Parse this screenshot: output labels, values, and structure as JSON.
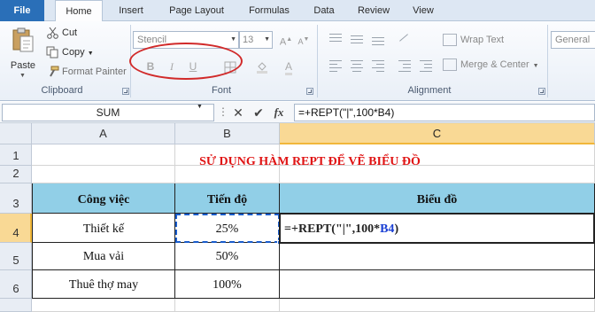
{
  "ribbon_tabs": {
    "file": "File",
    "home": "Home",
    "insert": "Insert",
    "page_layout": "Page Layout",
    "formulas": "Formulas",
    "data": "Data",
    "review": "Review",
    "view": "View"
  },
  "clipboard": {
    "paste": "Paste",
    "cut": "Cut",
    "copy": "Copy",
    "format_painter": "Format Painter",
    "group_label": "Clipboard"
  },
  "font": {
    "name": "Stencil",
    "size": "13",
    "bold": "B",
    "italic": "I",
    "underline": "U",
    "grow": "A",
    "shrink": "A",
    "font_color": "A",
    "group_label": "Font"
  },
  "alignment": {
    "wrap_text": "Wrap Text",
    "merge_center": "Merge & Center",
    "group_label": "Alignment"
  },
  "number": {
    "format": "General"
  },
  "formula_bar": {
    "name_box": "SUM",
    "cancel": "✕",
    "enter": "✔",
    "fx": "fx",
    "formula": "=+REPT(\"|\",100*B4)"
  },
  "sheet": {
    "columns": [
      "A",
      "B",
      "C"
    ],
    "rows": [
      "1",
      "2",
      "3",
      "4",
      "5",
      "6"
    ],
    "title": "SỬ DỤNG HÀM REPT ĐỂ VẼ BIỂU ĐỒ",
    "headers": [
      "Công việc",
      "Tiến độ",
      "Biểu đồ"
    ],
    "data_rows": [
      {
        "task": "Thiết kế",
        "progress": "25%"
      },
      {
        "task": "Mua vải",
        "progress": "50%"
      },
      {
        "task": "Thuê thợ may",
        "progress": "100%"
      }
    ],
    "editing_formula_prefix": "=+REPT(\"|\",100*",
    "editing_formula_ref": "B4",
    "editing_formula_suffix": ")"
  },
  "colors": {
    "file_tab": "#2a6fb8",
    "header_fill": "#91cfe7",
    "title_red": "#e01414",
    "annotation_oval": "#d12a2a",
    "cell_ref_blue": "#1a3fd4"
  }
}
